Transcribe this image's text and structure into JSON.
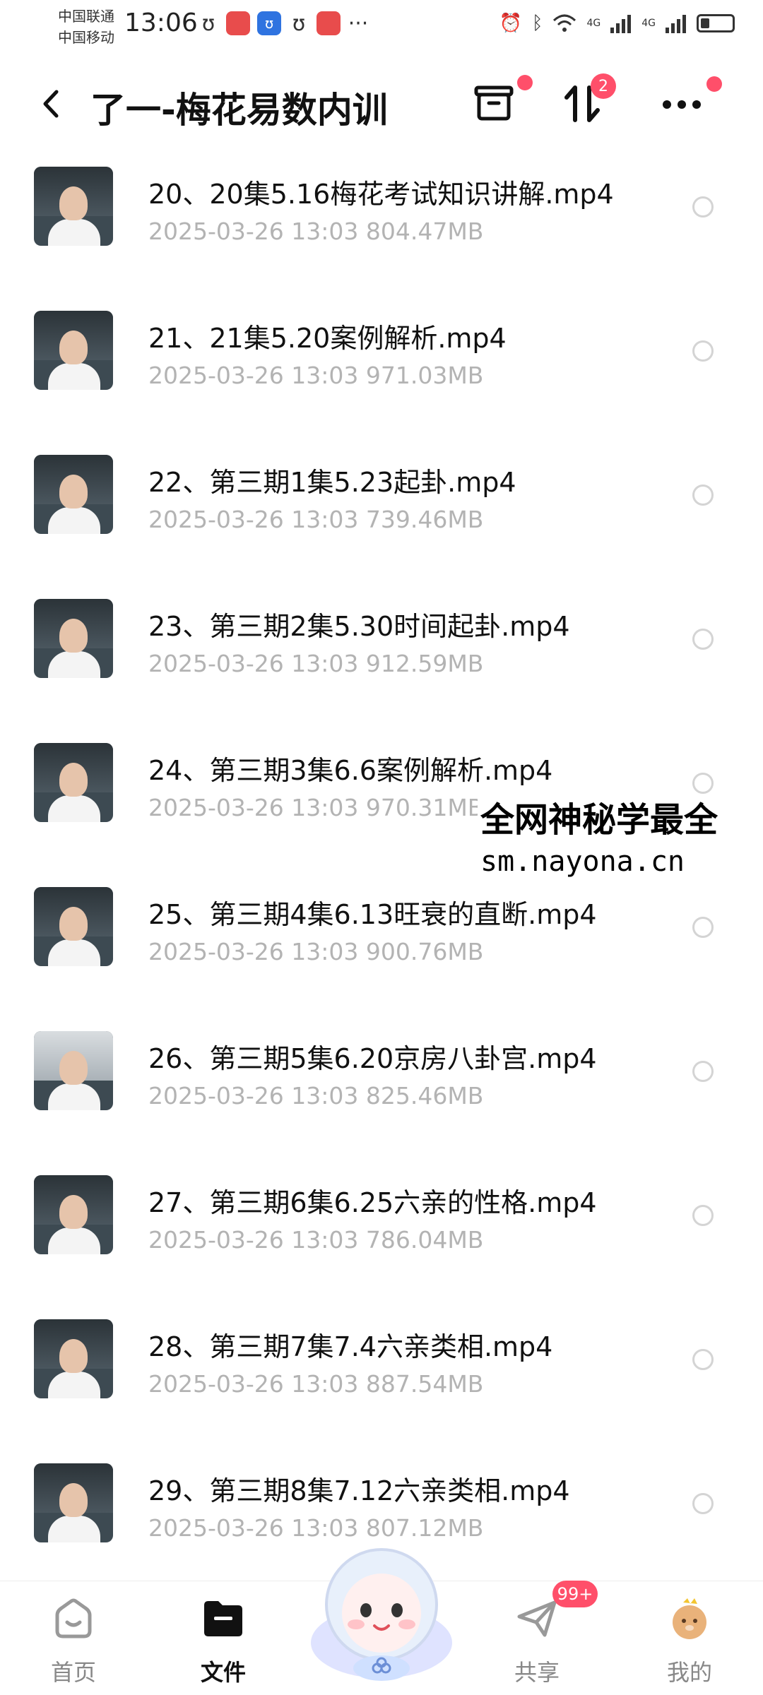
{
  "status_bar": {
    "carrier_1": "中国联通",
    "carrier_2": "中国移动",
    "time": "13:06",
    "net_1": "4G",
    "net_2": "4G"
  },
  "header": {
    "title": "了一-梅花易数内训",
    "sort_badge": "2"
  },
  "files": [
    {
      "name": "20、20集5.16梅花考试知识讲解.mp4",
      "meta": "2025-03-26   13:03   804.47MB"
    },
    {
      "name": "21、21集5.20案例解析.mp4",
      "meta": "2025-03-26   13:03   971.03MB"
    },
    {
      "name": "22、第三期1集5.23起卦.mp4",
      "meta": "2025-03-26   13:03   739.46MB"
    },
    {
      "name": "23、第三期2集5.30时间起卦.mp4",
      "meta": "2025-03-26   13:03   912.59MB"
    },
    {
      "name": "24、第三期3集6.6案例解析.mp4",
      "meta": "2025-03-26   13:03   970.31MB"
    },
    {
      "name": "25、第三期4集6.13旺衰的直断.mp4",
      "meta": "2025-03-26   13:03   900.76MB"
    },
    {
      "name": "26、第三期5集6.20京房八卦宫.mp4",
      "meta": "2025-03-26   13:03   825.46MB"
    },
    {
      "name": "27、第三期6集6.25六亲的性格.mp4",
      "meta": "2025-03-26   13:03   786.04MB"
    },
    {
      "name": "28、第三期7集7.4六亲类相.mp4",
      "meta": "2025-03-26   13:03   887.54MB"
    },
    {
      "name": "29、第三期8集7.12六亲类相.mp4",
      "meta": "2025-03-26   13:03   807.12MB"
    }
  ],
  "watermark": {
    "line1": "全网神秘学最全",
    "line2": "sm.nayona.cn"
  },
  "nav": {
    "home": "首页",
    "files": "文件",
    "share": "共享",
    "share_badge": "99+",
    "me": "我的"
  },
  "colors": {
    "accent": "#ff4f6a",
    "meta_text": "#b3b3b3"
  }
}
